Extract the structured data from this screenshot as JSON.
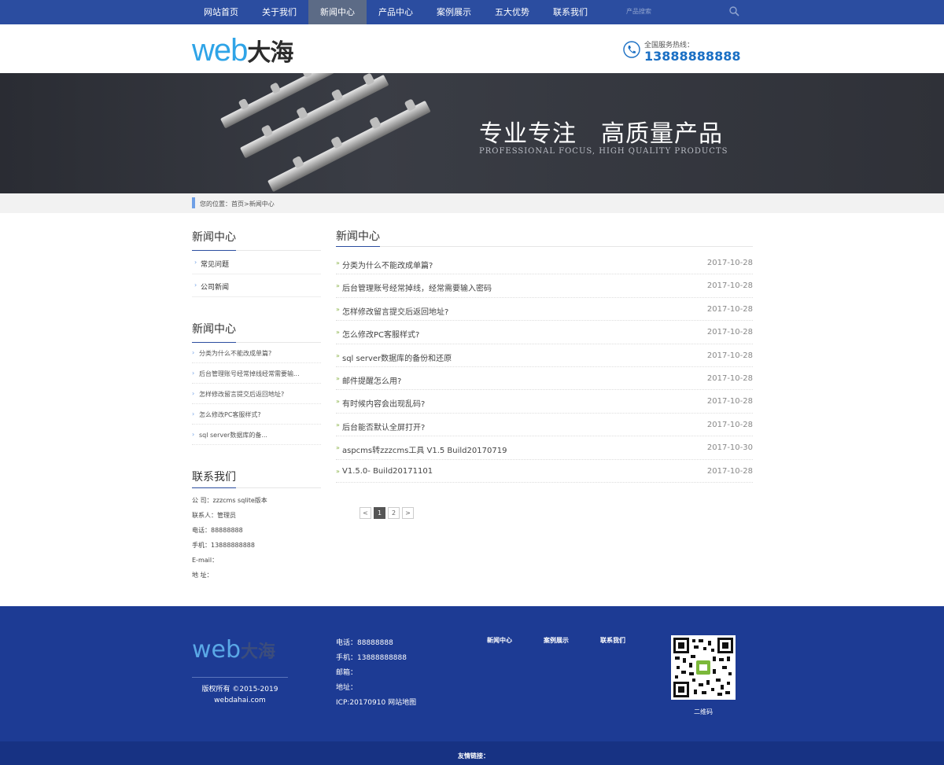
{
  "nav": {
    "items": [
      {
        "label": "网站首页",
        "active": false
      },
      {
        "label": "关于我们",
        "active": false
      },
      {
        "label": "新闻中心",
        "active": true
      },
      {
        "label": "产品中心",
        "active": false
      },
      {
        "label": "案例展示",
        "active": false
      },
      {
        "label": "五大优势",
        "active": false
      },
      {
        "label": "联系我们",
        "active": false
      }
    ],
    "search_placeholder": "产品搜索"
  },
  "header": {
    "logo_latin": "web",
    "logo_cjk": "大海",
    "hotline_label": "全国服务热线：",
    "hotline_number": "13888888888"
  },
  "banner": {
    "title": "专业专注　高质量产品",
    "subtitle": "PROFESSIONAL FOCUS, HIGH QUALITY PRODUCTS"
  },
  "breadcrumb": "您的位置：首页>新闻中心",
  "sidebar": {
    "categories_title": "新闻中心",
    "categories": [
      "常见问题",
      "公司新闻"
    ],
    "news_title": "新闻中心",
    "news": [
      "分类为什么不能改成单篇?",
      "后台管理账号经常掉线经常需要输...",
      "怎样修改留言提交后返回地址?",
      "怎么修改PC客服样式?",
      "sql server数据库的备..."
    ],
    "contact_title": "联系我们",
    "contact": [
      "公 司：zzzcms sqlite版本",
      "联系人：管理员",
      "电话：88888888",
      "手机：13888888888",
      "E-mail：",
      "地 址："
    ]
  },
  "main": {
    "title": "新闻中心",
    "list": [
      {
        "title": "分类为什么不能改成单篇?",
        "date": "2017-10-28"
      },
      {
        "title": "后台管理账号经常掉线，经常需要输入密码",
        "date": "2017-10-28"
      },
      {
        "title": "怎样修改留言提交后返回地址?",
        "date": "2017-10-28"
      },
      {
        "title": "怎么修改PC客服样式?",
        "date": "2017-10-28"
      },
      {
        "title": "sql server数据库的备份和还原",
        "date": "2017-10-28"
      },
      {
        "title": "邮件提醒怎么用?",
        "date": "2017-10-28"
      },
      {
        "title": "有时候内容会出现乱码?",
        "date": "2017-10-28"
      },
      {
        "title": "后台能否默认全屏打开?",
        "date": "2017-10-28"
      },
      {
        "title": "aspcms转zzzcms工具 V1.5 Build20170719",
        "date": "2017-10-30"
      },
      {
        "title": "V1.5.0- Build20171101",
        "date": "2017-10-28"
      }
    ],
    "pager": {
      "prev": "<",
      "pages": [
        "1",
        "2"
      ],
      "current": "1",
      "next": ">"
    }
  },
  "footer": {
    "logo_latin": "web",
    "logo_cjk": "大海",
    "copyright": "版权所有 ©2015-2019",
    "domain": "webdahai.com",
    "info": [
      "电话：88888888",
      "手机：13888888888",
      "邮箱：",
      "地址：",
      "ICP:20170910  网站地图"
    ],
    "nav": [
      "新闻中心",
      "案例展示",
      "联系我们"
    ],
    "qr_label": "二维码"
  },
  "links_label": "友情链接：",
  "colors": {
    "nav_bg": "#2b4da0",
    "nav_active": "#5c6b86",
    "footer_bg": "#1d3b94",
    "logo_blue": "#2fa4e7",
    "hotline": "#1a6fc4"
  }
}
